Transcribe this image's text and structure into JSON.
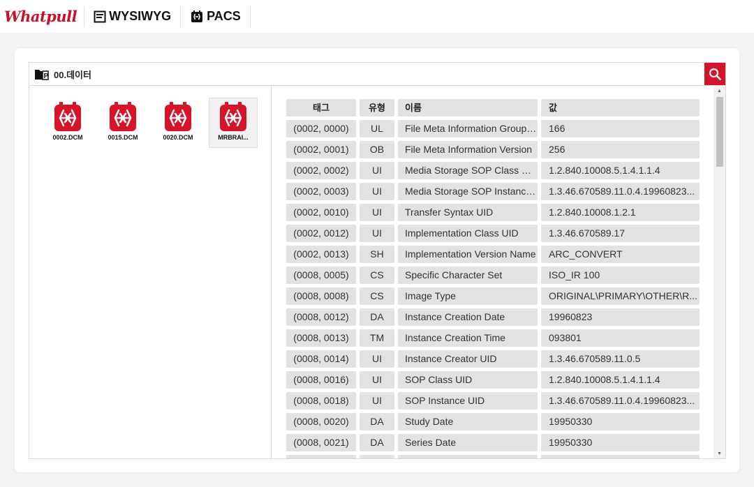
{
  "header": {
    "brand": "Whatpull",
    "tabs": [
      {
        "label": "WYSIWYG",
        "icon": "document-icon"
      },
      {
        "label": "PACS",
        "icon": "pacs-icon"
      }
    ]
  },
  "toolbar": {
    "path": "00.데이터"
  },
  "files": [
    {
      "name": "0002.DCM",
      "selected": false
    },
    {
      "name": "0015.DCM",
      "selected": false
    },
    {
      "name": "0020.DCM",
      "selected": false
    },
    {
      "name": "MRBRAI...",
      "selected": true
    }
  ],
  "table": {
    "headers": {
      "tag": "태그",
      "vr": "유형",
      "name": "이름",
      "value": "값"
    },
    "rows": [
      {
        "tag": "(0002, 0000)",
        "vr": "UL",
        "name": "File Meta Information Group Length",
        "value": "166"
      },
      {
        "tag": "(0002, 0001)",
        "vr": "OB",
        "name": "File Meta Information Version",
        "value": "256"
      },
      {
        "tag": "(0002, 0002)",
        "vr": "UI",
        "name": "Media Storage SOP Class UID",
        "value": "1.2.840.10008.5.1.4.1.1.4"
      },
      {
        "tag": "(0002, 0003)",
        "vr": "UI",
        "name": "Media Storage SOP Instance UID",
        "value": "1.3.46.670589.11.0.4.19960823..."
      },
      {
        "tag": "(0002, 0010)",
        "vr": "UI",
        "name": "Transfer Syntax UID",
        "value": "1.2.840.10008.1.2.1"
      },
      {
        "tag": "(0002, 0012)",
        "vr": "UI",
        "name": "Implementation Class UID",
        "value": "1.3.46.670589.17"
      },
      {
        "tag": "(0002, 0013)",
        "vr": "SH",
        "name": "Implementation Version Name",
        "value": "ARC_CONVERT"
      },
      {
        "tag": "(0008, 0005)",
        "vr": "CS",
        "name": "Specific Character Set",
        "value": "ISO_IR 100"
      },
      {
        "tag": "(0008, 0008)",
        "vr": "CS",
        "name": "Image Type",
        "value": "ORIGINAL\\PRIMARY\\OTHER\\R..."
      },
      {
        "tag": "(0008, 0012)",
        "vr": "DA",
        "name": "Instance Creation Date",
        "value": "19960823"
      },
      {
        "tag": "(0008, 0013)",
        "vr": "TM",
        "name": "Instance Creation Time",
        "value": "093801"
      },
      {
        "tag": "(0008, 0014)",
        "vr": "UI",
        "name": "Instance Creator UID",
        "value": "1.3.46.670589.11.0.5"
      },
      {
        "tag": "(0008, 0016)",
        "vr": "UI",
        "name": "SOP Class UID",
        "value": "1.2.840.10008.5.1.4.1.1.4"
      },
      {
        "tag": "(0008, 0018)",
        "vr": "UI",
        "name": "SOP Instance UID",
        "value": "1.3.46.670589.11.0.4.19960823..."
      },
      {
        "tag": "(0008, 0020)",
        "vr": "DA",
        "name": "Study Date",
        "value": "19950330"
      },
      {
        "tag": "(0008, 0021)",
        "vr": "DA",
        "name": "Series Date",
        "value": "19950330"
      },
      {
        "tag": "",
        "vr": "",
        "name": "",
        "value": ""
      }
    ]
  },
  "colors": {
    "accent": "#d7132a",
    "brand": "#c8102e"
  }
}
